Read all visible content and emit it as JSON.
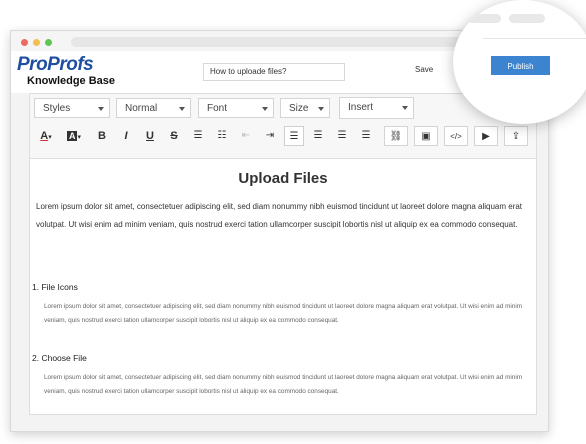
{
  "logo": {
    "main": "ProProfs",
    "sub": "Knowledge Base"
  },
  "header": {
    "title_value": "How to uploade files?",
    "save_label": "Save",
    "publish_label": "Publish"
  },
  "toolbar": {
    "styles_label": "Styles",
    "format_label": "Normal",
    "font_label": "Font",
    "size_label": "Size",
    "insert_label": "Insert"
  },
  "document": {
    "title": "Upload Files",
    "lead": "Lorem ipsum dolor sit amet, consectetuer adipiscing elit, sed diam nonummy nibh euismod tincidunt ut laoreet dolore magna aliquam erat volutpat. Ut wisi enim ad minim veniam, quis nostrud exerci tation ullamcorper suscipit lobortis nisl ut aliquip ex ea commodo consequat.",
    "sections": [
      {
        "heading": "1. File Icons",
        "body": "Lorem ipsum dolor sit amet, consectetuer adipiscing elit, sed diam nonummy nibh euismod tincidunt ut laoreet dolore magna aliquam erat volutpat. Ut wisi enim ad minim veniam, quis nostrud exerci tation ullamcorper suscipit lobortis nisl ut aliquip ex ea commodo consequat."
      },
      {
        "heading": "2. Choose File",
        "body": "Lorem ipsum dolor sit amet, consectetuer adipiscing elit, sed diam nonummy nibh euismod tincidunt ut laoreet dolore magna aliquam erat volutpat. Ut wisi enim ad minim veniam, quis nostrud exerci tation ullamcorper suscipit lobortis nisl ut aliquip ex ea commodo consequat."
      }
    ]
  },
  "colors": {
    "brand": "#1f4fa3",
    "publish": "#3d84d0",
    "dot_red": "#ee6a5e",
    "dot_yellow": "#f5be4f",
    "dot_green": "#61c554"
  }
}
